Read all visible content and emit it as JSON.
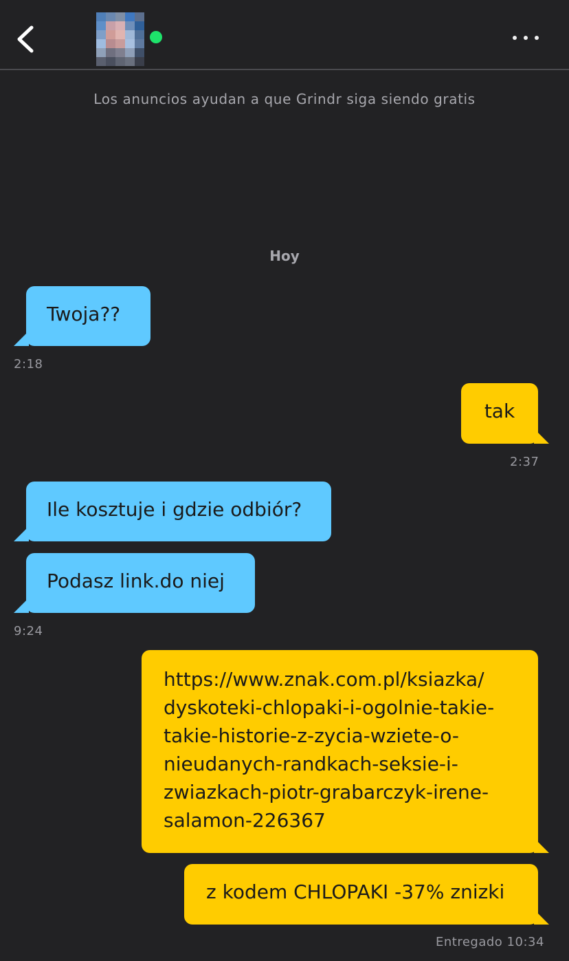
{
  "header": {
    "back_icon": "chevron-left-icon",
    "online_color": "#1ee36b",
    "more_icon": "more-horizontal-icon"
  },
  "ads_notice": "Los anuncios ayudan a que Grindr siga siendo gratis",
  "day_label": "Hoy",
  "colors": {
    "incoming": "#5fc9ff",
    "outgoing": "#ffcc00",
    "background": "#222224"
  },
  "messages": [
    {
      "direction": "incoming",
      "text": "Twoja??"
    },
    {
      "direction": "outgoing",
      "text": "tak"
    },
    {
      "direction": "incoming",
      "text": "Ile kosztuje i gdzie odbiór?"
    },
    {
      "direction": "incoming",
      "text": "Podasz link.do niej"
    },
    {
      "direction": "outgoing",
      "text": "https://www.znak.com.pl/ksiazka/\ndyskoteki-chlopaki-i-ogolnie-takie-\ntakie-historie-z-zycia-wziete-o-\nnieudanych-randkach-seksie-i-\nzwiazkach-piotr-grabarczyk-irene-\nsalamon-226367"
    },
    {
      "direction": "outgoing",
      "text": "z kodem CHLOPAKI -37% znizki"
    }
  ],
  "timestamps": {
    "t1": "2:18",
    "t2": "2:37",
    "t3": "9:24",
    "t4": "Entregado 10:34"
  }
}
